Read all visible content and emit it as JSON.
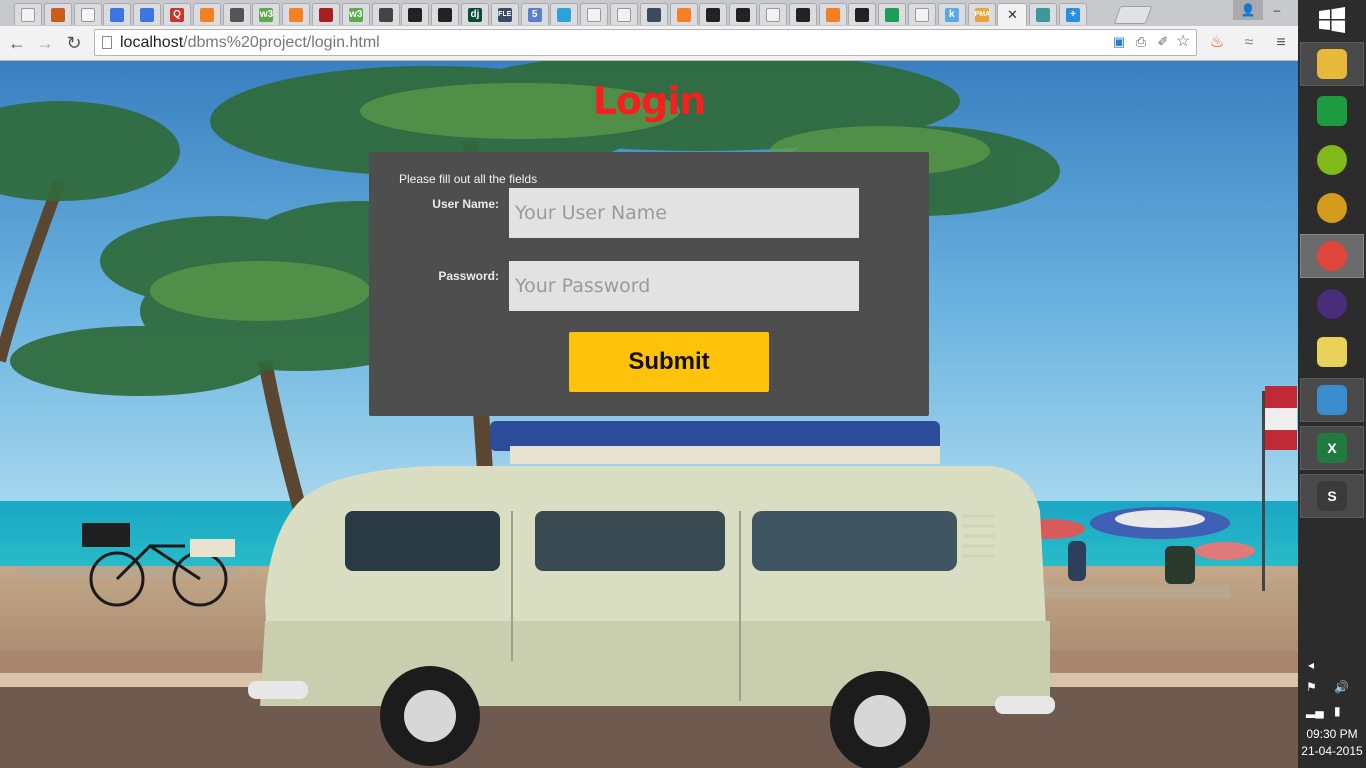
{
  "browser": {
    "tabs": [
      {
        "icon": "blank-page-icon",
        "color": "#f2f2f2"
      },
      {
        "icon": "lion-icon",
        "color": "#c85d1c"
      },
      {
        "icon": "cd-icon",
        "color": "#f2f2f2",
        "glyph": "CD"
      },
      {
        "icon": "docs-icon",
        "color": "#3b76e4"
      },
      {
        "icon": "docs-icon",
        "color": "#3b76e4"
      },
      {
        "icon": "q-icon",
        "color": "#c9342b",
        "glyph": "Q"
      },
      {
        "icon": "stackoverflow-icon",
        "color": "#f48024"
      },
      {
        "icon": "owl-icon",
        "color": "#555555"
      },
      {
        "icon": "w3schools-icon",
        "color": "#5eaa4c",
        "glyph": "w3"
      },
      {
        "icon": "stackoverflow-icon",
        "color": "#f48024"
      },
      {
        "icon": "star-icon",
        "color": "#a81f1f"
      },
      {
        "icon": "w3schools-icon",
        "color": "#5eaa4c",
        "glyph": "w3"
      },
      {
        "icon": "diamond-icon",
        "color": "#444444"
      },
      {
        "icon": "github-icon",
        "color": "#222222"
      },
      {
        "icon": "github-icon",
        "color": "#222222"
      },
      {
        "icon": "django-icon",
        "color": "#0c4b33",
        "glyph": "dj"
      },
      {
        "icon": "flex-icon",
        "color": "#3a4a6a",
        "glyph": "FLE"
      },
      {
        "icon": "html5-icon",
        "color": "#5a7fd1",
        "glyph": "5"
      },
      {
        "icon": "circle-icon",
        "color": "#2ba3d8"
      },
      {
        "icon": "blank-page-icon",
        "color": "#f2f2f2"
      },
      {
        "icon": "blank-page-icon",
        "color": "#f2f2f2"
      },
      {
        "icon": "stripe-icon",
        "color": "#3c4a59"
      },
      {
        "icon": "stackoverflow-icon",
        "color": "#f48024"
      },
      {
        "icon": "github-icon",
        "color": "#222222"
      },
      {
        "icon": "github-icon",
        "color": "#222222"
      },
      {
        "icon": "blank-page-icon",
        "color": "#f2f2f2"
      },
      {
        "icon": "github-icon",
        "color": "#222222"
      },
      {
        "icon": "stackoverflow-icon",
        "color": "#f48024"
      },
      {
        "icon": "github-icon",
        "color": "#222222"
      },
      {
        "icon": "sheets-icon",
        "color": "#1e9e54"
      },
      {
        "icon": "blank-page-icon",
        "color": "#f2f2f2"
      },
      {
        "icon": "k-icon",
        "color": "#5aa9e6",
        "glyph": "k"
      },
      {
        "icon": "phpmyadmin-icon",
        "color": "#e8a43a",
        "glyph": "PMA"
      },
      {
        "icon": "blank-page-icon",
        "color": "#f2f2f2",
        "active": true
      },
      {
        "icon": "s-circle-icon",
        "color": "#3a9a9a"
      },
      {
        "icon": "plus-icon",
        "color": "#2b8ee0",
        "glyph": "+"
      }
    ],
    "url_host": "localhost",
    "url_path": "/dbms%20project/login.html"
  },
  "page": {
    "title": "Login",
    "hint": "Please fill out all the fields",
    "username_label": "User Name:",
    "username_placeholder": "Your User Name",
    "password_label": "Password:",
    "password_placeholder": "Your Password",
    "submit_label": "Submit"
  },
  "colors": {
    "title": "#f41f1f",
    "panel": "#4e4e4e",
    "submit": "#ffc20a"
  },
  "taskbar": {
    "items": [
      {
        "icon": "file-explorer-icon",
        "color": "#e8b83a"
      },
      {
        "icon": "store-icon",
        "color": "#1d9b3f"
      },
      {
        "icon": "spotify-icon",
        "color": "#80b918"
      },
      {
        "icon": "media-player-icon",
        "color": "#d59b1b"
      },
      {
        "icon": "chrome-icon",
        "color": "#e0463a",
        "focused": true
      },
      {
        "icon": "eclipse-icon",
        "color": "#4a2d7a"
      },
      {
        "icon": "sticky-notes-icon",
        "color": "#e8d25a"
      },
      {
        "icon": "photos-icon",
        "color": "#3a8ed0"
      },
      {
        "icon": "excel-icon",
        "color": "#1f7a3e",
        "glyph": "X"
      },
      {
        "icon": "sublime-text-icon",
        "color": "#3b3b3b",
        "glyph": "S"
      }
    ],
    "time": "09:30 PM",
    "date": "21-04-2015"
  }
}
